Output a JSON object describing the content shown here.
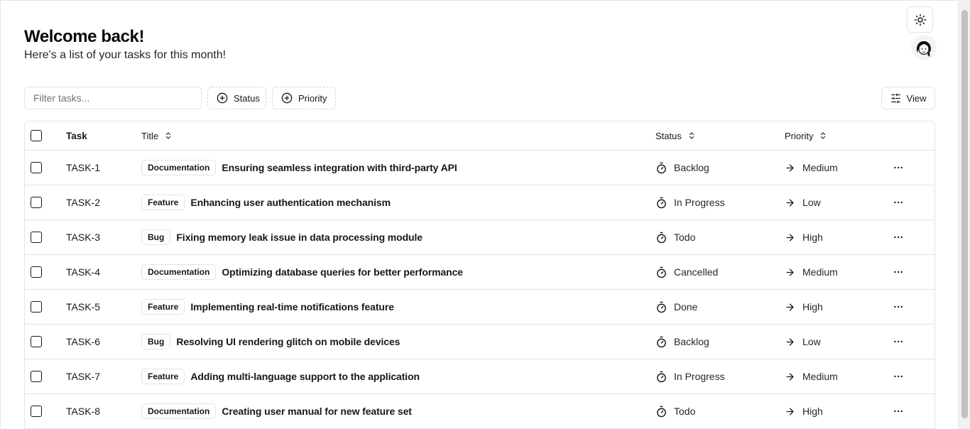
{
  "header": {
    "title": "Welcome back!",
    "subtitle": "Here's a list of your tasks for this month!"
  },
  "toolbar": {
    "filter_placeholder": "Filter tasks...",
    "filter_value": "",
    "status_facet_label": "Status",
    "priority_facet_label": "Priority",
    "view_label": "View"
  },
  "icons": {
    "theme_toggle": "sun-icon",
    "avatar": "user-avatar",
    "facet": "plus-circle-icon",
    "view": "sliders-icon",
    "sort": "chevrons-up-down-icon",
    "status": "timer-icon",
    "priority": "arrow-right-icon",
    "actions": "more-horizontal-icon"
  },
  "table": {
    "columns": {
      "task": "Task",
      "title": "Title",
      "status": "Status",
      "priority": "Priority"
    },
    "rows": [
      {
        "id": "TASK-1",
        "label": "Documentation",
        "title": "Ensuring seamless integration with third-party API",
        "status": "Backlog",
        "priority": "Medium"
      },
      {
        "id": "TASK-2",
        "label": "Feature",
        "title": "Enhancing user authentication mechanism",
        "status": "In Progress",
        "priority": "Low"
      },
      {
        "id": "TASK-3",
        "label": "Bug",
        "title": "Fixing memory leak issue in data processing module",
        "status": "Todo",
        "priority": "High"
      },
      {
        "id": "TASK-4",
        "label": "Documentation",
        "title": "Optimizing database queries for better performance",
        "status": "Cancelled",
        "priority": "Medium"
      },
      {
        "id": "TASK-5",
        "label": "Feature",
        "title": "Implementing real-time notifications feature",
        "status": "Done",
        "priority": "High"
      },
      {
        "id": "TASK-6",
        "label": "Bug",
        "title": "Resolving UI rendering glitch on mobile devices",
        "status": "Backlog",
        "priority": "Low"
      },
      {
        "id": "TASK-7",
        "label": "Feature",
        "title": "Adding multi-language support to the application",
        "status": "In Progress",
        "priority": "Medium"
      },
      {
        "id": "TASK-8",
        "label": "Documentation",
        "title": "Creating user manual for new feature set",
        "status": "Todo",
        "priority": "High"
      }
    ]
  }
}
